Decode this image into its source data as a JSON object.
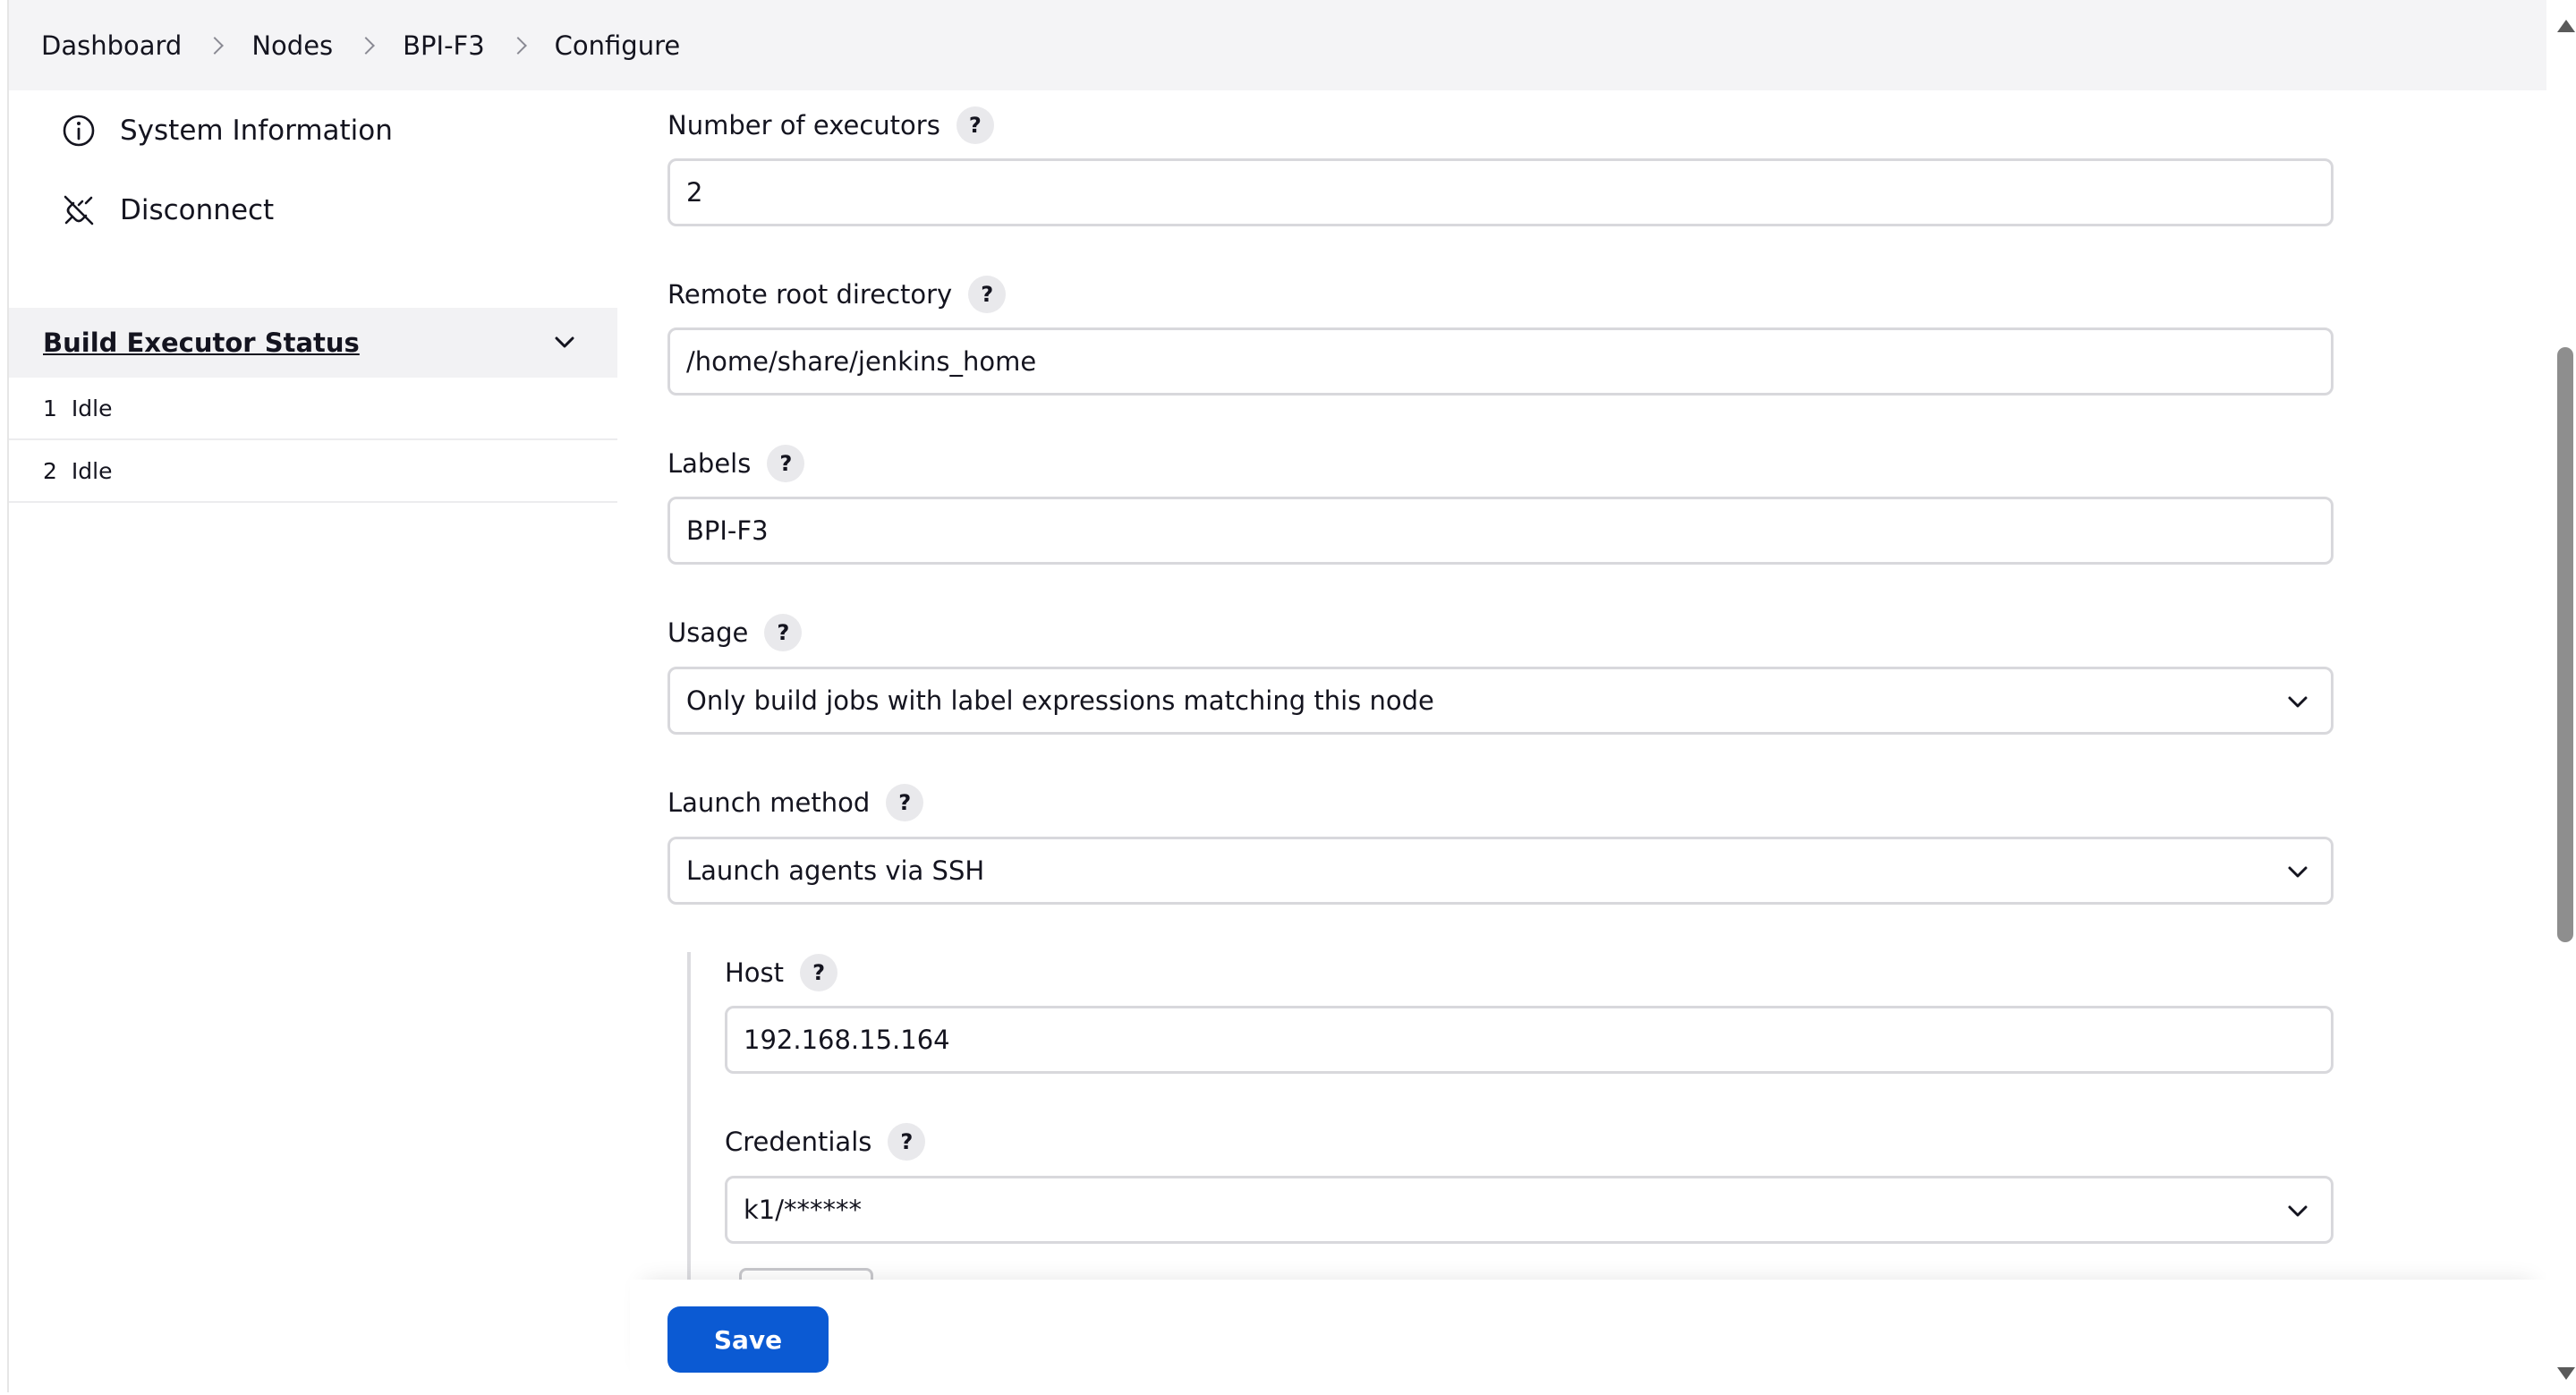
{
  "breadcrumb": {
    "items": [
      {
        "label": "Dashboard"
      },
      {
        "label": "Nodes"
      },
      {
        "label": "BPI-F3"
      },
      {
        "label": "Configure"
      }
    ]
  },
  "sidebar": {
    "tasks": [
      {
        "label": "System Information",
        "icon": "info-icon"
      },
      {
        "label": "Disconnect",
        "icon": "disconnect-icon"
      }
    ],
    "executor_status": {
      "title": "Build Executor Status",
      "executors": [
        {
          "number": "1",
          "state": "Idle"
        },
        {
          "number": "2",
          "state": "Idle"
        }
      ]
    }
  },
  "form": {
    "executors": {
      "label": "Number of executors",
      "value": "2"
    },
    "remote_root": {
      "label": "Remote root directory",
      "value": "/home/share/jenkins_home"
    },
    "labels": {
      "label": "Labels",
      "value": "BPI-F3"
    },
    "usage": {
      "label": "Usage",
      "value": "Only build jobs with label expressions matching this node"
    },
    "launch_method": {
      "label": "Launch method",
      "value": "Launch agents via SSH"
    },
    "host": {
      "label": "Host",
      "value": "192.168.15.164"
    },
    "credentials": {
      "label": "Credentials",
      "value": "k1/******"
    },
    "help_glyph": "?"
  },
  "actions": {
    "save_label": "Save"
  },
  "colors": {
    "primary": "#0b5ad3",
    "sidebar_header_bg": "#f2f2f4",
    "breadcrumb_bg": "#f4f4f6"
  }
}
